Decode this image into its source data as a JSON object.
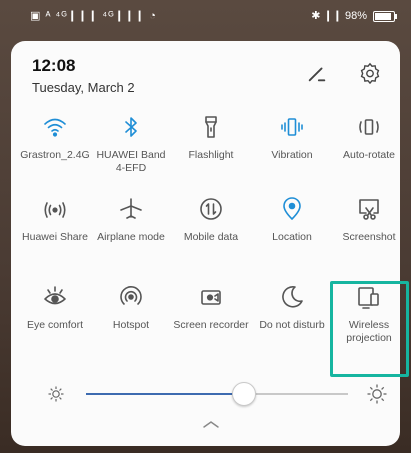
{
  "status_bar": {
    "left": "▣ ᴬ ⁴ᴳ❙❙❙ ⁴ᴳ❙❙❙ ◔",
    "battery_text": "✱ ❙❙ 98%",
    "battery_level": 0.98
  },
  "header": {
    "time": "12:08",
    "date": "Tuesday, March 2"
  },
  "tiles": [
    {
      "label": "Grastron_2.4G",
      "icon": "wifi-icon",
      "active": true
    },
    {
      "label": "HUAWEI Band 4-EFD",
      "icon": "bluetooth-icon",
      "active": true
    },
    {
      "label": "Flashlight",
      "icon": "flashlight-icon",
      "active": false
    },
    {
      "label": "Vibration",
      "icon": "vibration-icon",
      "active": true
    },
    {
      "label": "Auto-rotate",
      "icon": "auto-rotate-icon",
      "active": false
    },
    {
      "label": "Huawei Share",
      "icon": "huawei-share-icon",
      "active": false
    },
    {
      "label": "Airplane mode",
      "icon": "airplane-icon",
      "active": false
    },
    {
      "label": "Mobile data",
      "icon": "mobile-data-icon",
      "active": false
    },
    {
      "label": "Location",
      "icon": "location-icon",
      "active": true
    },
    {
      "label": "Screenshot",
      "icon": "screenshot-icon",
      "active": false
    },
    {
      "label": "Eye comfort",
      "icon": "eye-comfort-icon",
      "active": false
    },
    {
      "label": "Hotspot",
      "icon": "hotspot-icon",
      "active": false
    },
    {
      "label": "Screen recorder",
      "icon": "screen-recorder-icon",
      "active": false
    },
    {
      "label": "Do not disturb",
      "icon": "do-not-disturb-icon",
      "active": false
    },
    {
      "label": "Wireless projection",
      "icon": "wireless-projection-icon",
      "active": false
    }
  ],
  "brightness": {
    "level": 0.6
  },
  "colors": {
    "active": "#1f8ed6",
    "inactive": "#555555",
    "highlight": "#16b5a0",
    "slider": "#3d6bb0"
  }
}
